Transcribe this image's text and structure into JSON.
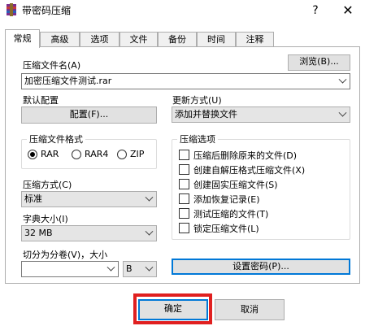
{
  "window": {
    "title": "带密码压缩",
    "help": "?",
    "close": "✕"
  },
  "tabs": [
    {
      "label": "常规",
      "active": true
    },
    {
      "label": "高级",
      "active": false
    },
    {
      "label": "选项",
      "active": false
    },
    {
      "label": "文件",
      "active": false
    },
    {
      "label": "备份",
      "active": false
    },
    {
      "label": "时间",
      "active": false
    },
    {
      "label": "注释",
      "active": false
    }
  ],
  "general": {
    "archive_name_label": "压缩文件名(A)",
    "archive_name_value": "加密压缩文件测试.rar",
    "browse_button": "浏览(B)...",
    "default_profile_label": "默认配置",
    "profiles_button": "配置(F)...",
    "update_mode_label": "更新方式(U)",
    "update_mode_value": "添加并替换文件",
    "format_group_label": "压缩文件格式",
    "formats": [
      {
        "label": "RAR",
        "checked": true
      },
      {
        "label": "RAR4",
        "checked": false
      },
      {
        "label": "ZIP",
        "checked": false
      }
    ],
    "method_label": "压缩方式(C)",
    "method_value": "标准",
    "dict_label": "字典大小(I)",
    "dict_value": "32 MB",
    "split_label": "切分为分卷(V)，大小",
    "split_value": "",
    "split_unit": "B",
    "options_group_label": "压缩选项",
    "options": [
      {
        "label": "压缩后删除原来的文件(D)",
        "checked": false
      },
      {
        "label": "创建自解压格式压缩文件(X)",
        "checked": false
      },
      {
        "label": "创建固实压缩文件(S)",
        "checked": false
      },
      {
        "label": "添加恢复记录(E)",
        "checked": false
      },
      {
        "label": "测试压缩的文件(T)",
        "checked": false
      },
      {
        "label": "锁定压缩文件(L)",
        "checked": false
      }
    ],
    "set_password_button": "设置密码(P)..."
  },
  "footer": {
    "ok_button": "确定",
    "cancel_button": "取消"
  },
  "colors": {
    "highlight": "#e02020",
    "focus": "#0078d7"
  }
}
